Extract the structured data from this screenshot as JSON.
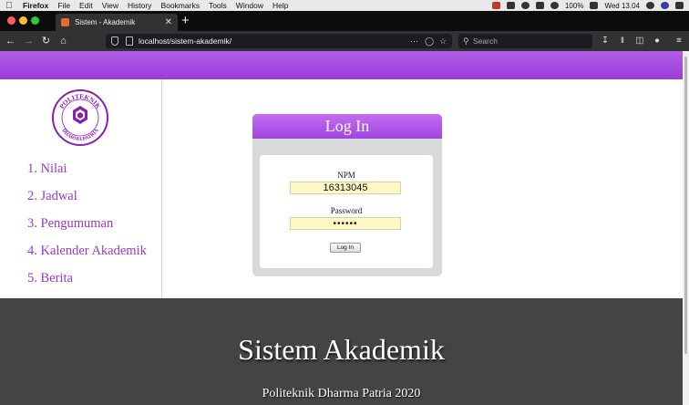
{
  "os_menubar": {
    "app_name": "Firefox",
    "menus": [
      "File",
      "Edit",
      "View",
      "History",
      "Bookmarks",
      "Tools",
      "Window",
      "Help"
    ],
    "battery": "100%",
    "clock": "Wed 13.04"
  },
  "browser": {
    "tab_title": "Sistem - Akademik",
    "url": "localhost/sistem-akademik/",
    "search_placeholder": "Search",
    "icons": {
      "back": "back-arrow-icon",
      "forward": "forward-arrow-icon",
      "reload": "reload-icon",
      "home": "home-icon",
      "page_actions": "ellipsis-icon",
      "pocket": "pocket-icon",
      "bookmark": "star-icon",
      "downloads": "download-icon",
      "library": "library-icon",
      "sidebar": "sidebar-icon",
      "account": "account-icon",
      "menu": "hamburger-menu-icon"
    }
  },
  "site": {
    "logo_text_top": "POLITEKNIK",
    "logo_text_bottom": "DHARMA PATRIA",
    "nav": [
      "1. Nilai",
      "2. Jadwal",
      "3. Pengumuman",
      "4. Kalender Akademik",
      "5. Berita"
    ],
    "login": {
      "title": "Log In",
      "npm_label": "NPM",
      "npm_value": "16313045",
      "password_label": "Password",
      "password_value": "••••••",
      "button": "Log In"
    },
    "footer": {
      "title": "Sistem Akademik",
      "subtitle": "Politeknik Dharma Patria 2020"
    },
    "colors": {
      "brand_purple": "#9b35d6",
      "footer_bg": "#444444",
      "input_bg": "#fdf8c4"
    }
  }
}
